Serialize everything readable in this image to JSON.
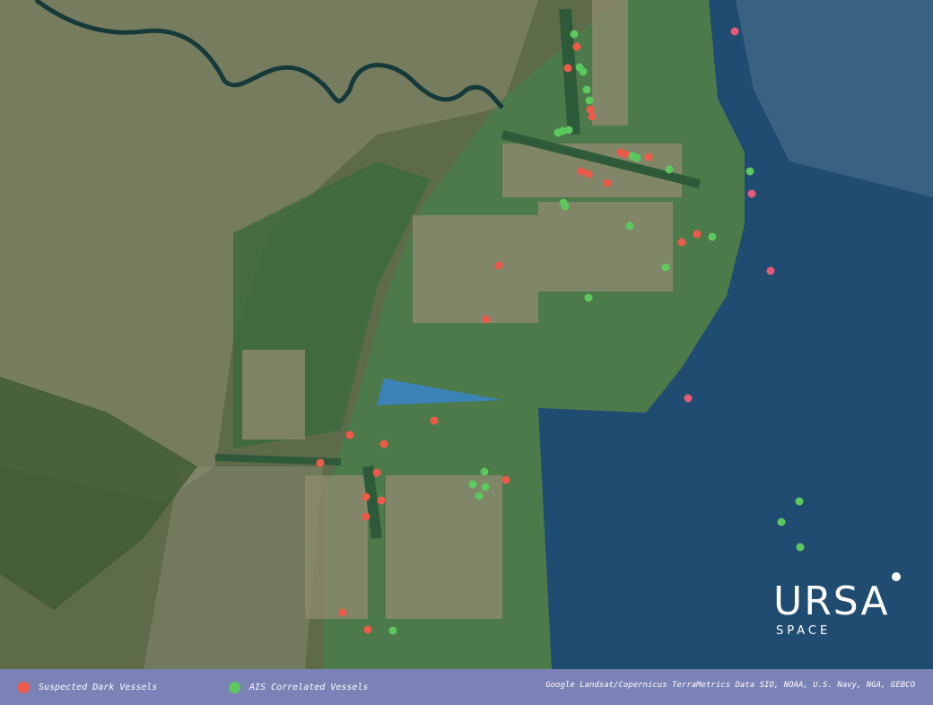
{
  "logo": {
    "name": "URSA",
    "tagline": "SPACE"
  },
  "legend": {
    "items": [
      {
        "label": "Suspected Dark Vessels",
        "color": "#ee5a4a"
      },
      {
        "label": "AIS Correlated Vessels",
        "color": "#5cc85e"
      }
    ],
    "attribution": "Google Landsat/Copernicus TerraMetrics Data SIO, NOAA, U.S. Navy, NGA, GEBCO"
  },
  "map_colors": {
    "land": "#5d6a4a",
    "urban": "#8a8b72",
    "shallow_water": "#4e7a4c",
    "deep_sea": "#1f4a6e",
    "river": "#163a3a",
    "lagoon": "#3b7fb4",
    "dark_vessel": "#ee5a4a",
    "ais_vessel": "#5cc85e",
    "offshore_dark_vessel": "#e85a78"
  }
}
